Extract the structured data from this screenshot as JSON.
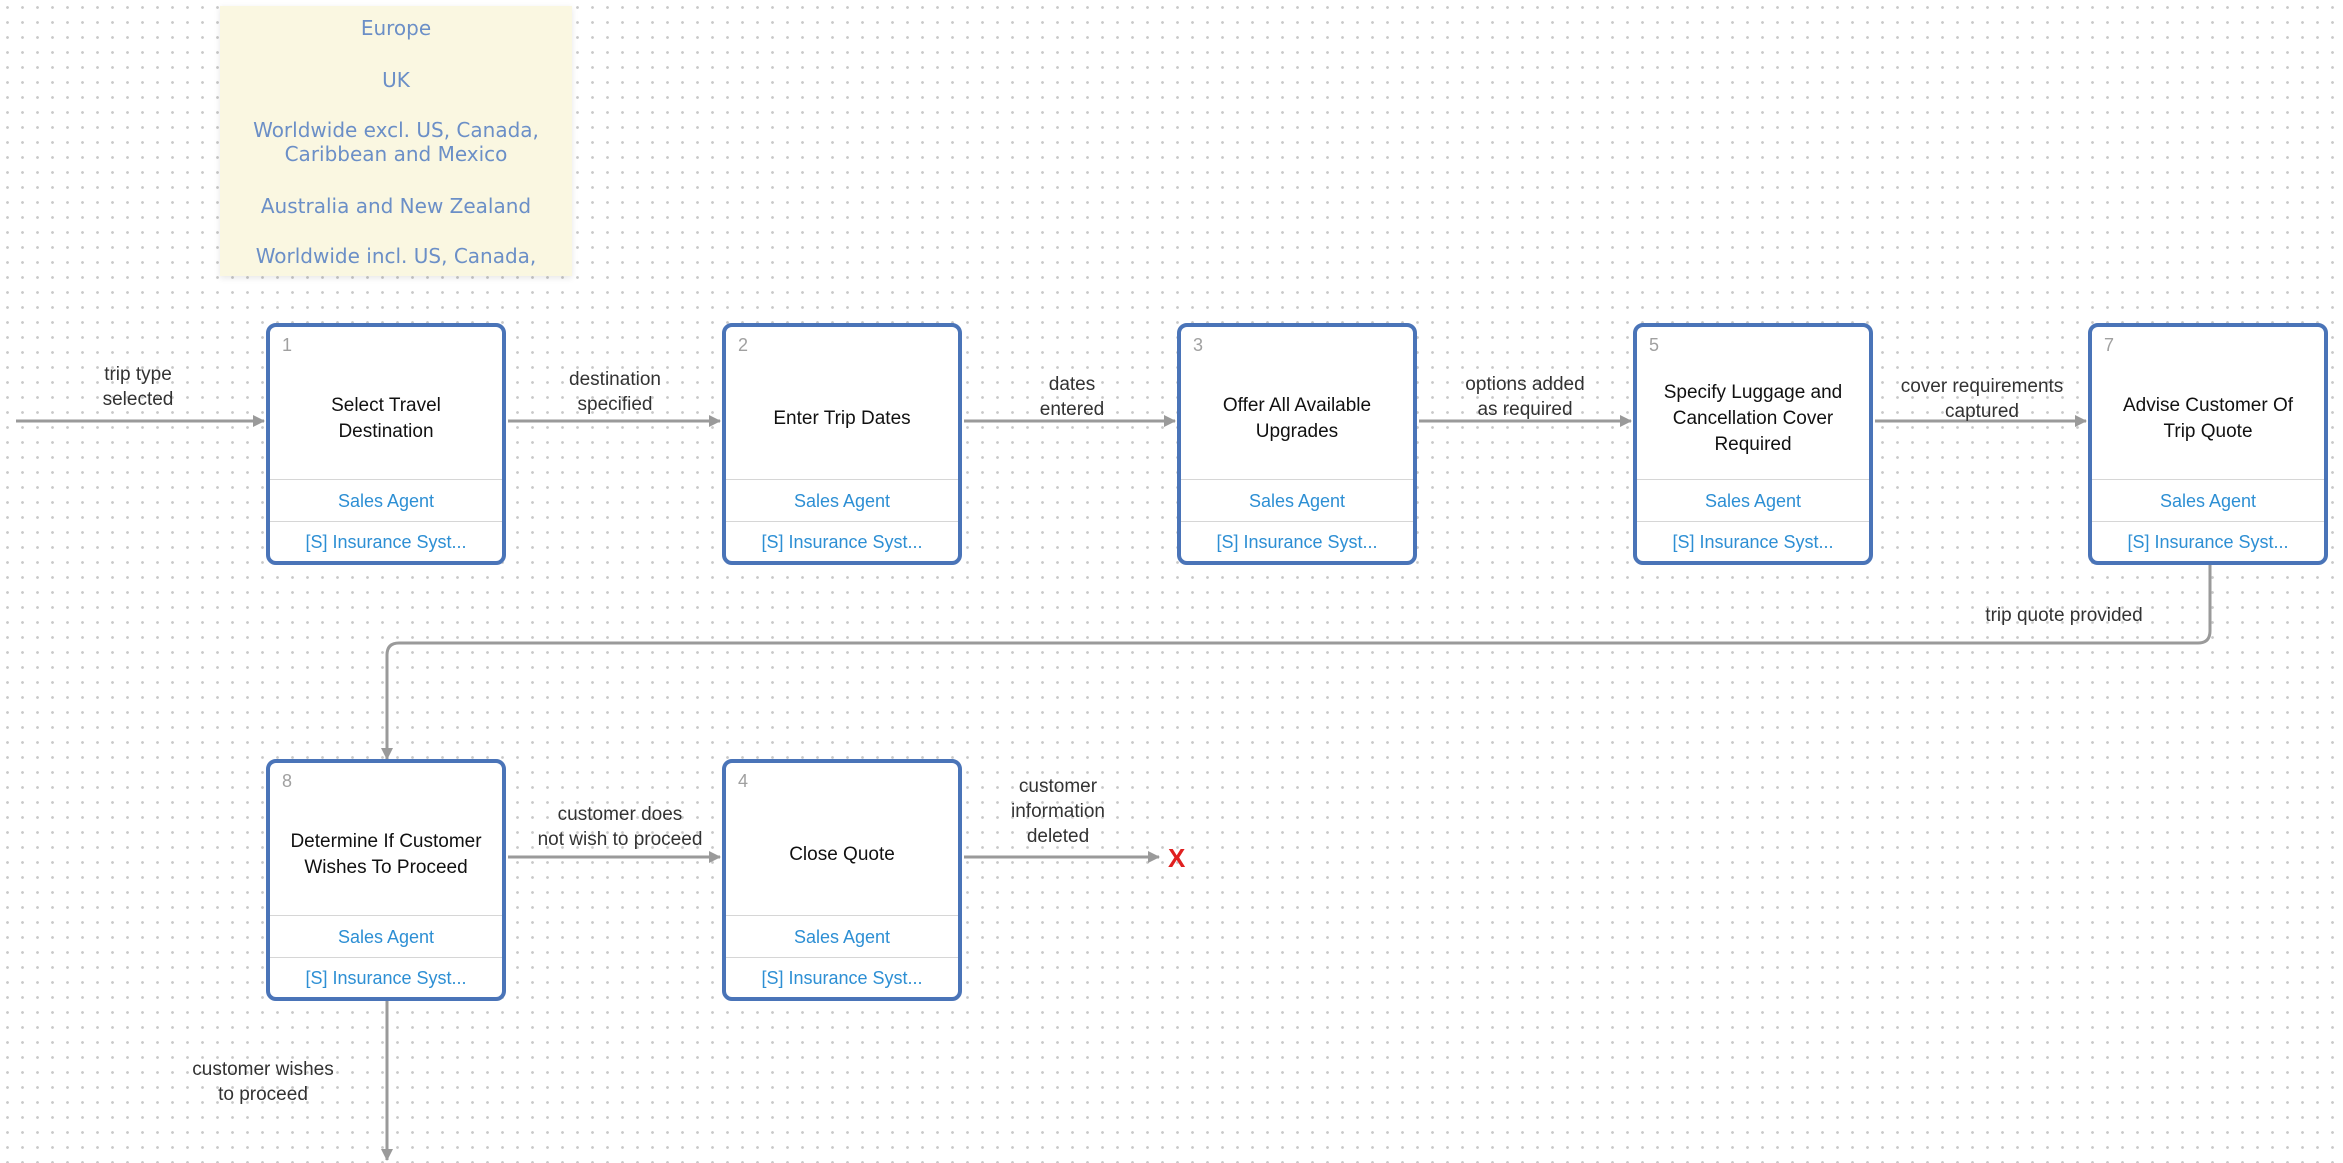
{
  "destination_dropdown": {
    "options": [
      "Europe",
      "UK",
      "Worldwide excl. US, Canada,\nCaribbean and Mexico",
      "Australia and New Zealand",
      "Worldwide incl. US, Canada,"
    ]
  },
  "nodes": [
    {
      "number": "1",
      "title": "Select Travel\nDestination",
      "role": "Sales Agent",
      "system": "[S] Insurance Syst..."
    },
    {
      "number": "2",
      "title": "Enter Trip Dates",
      "role": "Sales Agent",
      "system": "[S] Insurance Syst..."
    },
    {
      "number": "3",
      "title": "Offer All Available\nUpgrades",
      "role": "Sales Agent",
      "system": "[S] Insurance Syst..."
    },
    {
      "number": "5",
      "title": "Specify Luggage and\nCancellation Cover\nRequired",
      "role": "Sales Agent",
      "system": "[S] Insurance Syst..."
    },
    {
      "number": "7",
      "title": "Advise Customer Of\nTrip Quote",
      "role": "Sales Agent",
      "system": "[S] Insurance Syst..."
    },
    {
      "number": "8",
      "title": "Determine If Customer\nWishes To Proceed",
      "role": "Sales Agent",
      "system": "[S] Insurance Syst..."
    },
    {
      "number": "4",
      "title": "Close Quote",
      "role": "Sales Agent",
      "system": "[S] Insurance Syst..."
    }
  ],
  "edges": [
    "trip type\nselected",
    "destination\nspecified",
    "dates\nentered",
    "options added\nas required",
    "cover requirements\ncaptured",
    "trip quote provided",
    "customer does\nnot wish to proceed",
    "customer\ninformation\ndeleted",
    "customer wishes\nto proceed"
  ],
  "end_marker": "X",
  "colors": {
    "node_border": "#4a74b8",
    "connector": "#9a9a9a",
    "role_text": "#2d8fd4",
    "dropdown_bg": "#faf7e1",
    "dropdown_text": "#6b8fc7",
    "end_marker": "#e02020"
  }
}
